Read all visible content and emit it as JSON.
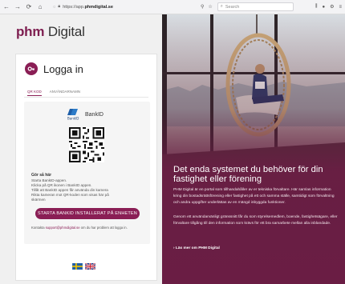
{
  "browser": {
    "url_prefix": "https://app.",
    "url_domain": "phmdigital.se",
    "search_placeholder": "Search"
  },
  "brand": {
    "phm": "phm",
    "digital": "Digital"
  },
  "login": {
    "title": "Logga in",
    "tabs": [
      "QR KOD",
      "ANVÄNDARNAMN"
    ],
    "bankid_label": "BankID",
    "how_title": "Gör så här",
    "steps": [
      "Starta BankID-appen.",
      "Klicka på QR ikonen i BankID appen.",
      "Tillåt att BankID appen får använda din kamera",
      "Rikta kameran mot QR-koden som visas här på",
      "skärmen"
    ],
    "start_button": "STARTA BANKID INSTALLERAT PÅ ENHETEN",
    "support_prefix": "Kontakta ",
    "support_link": "support@phmdigital.se",
    "support_suffix": " om du har problem att logga in."
  },
  "hero": {
    "title": "Det enda systemet du behöver för din fastighet eller förening",
    "p1": "PHM Digital är en portal som tillhandahåller av er tekniska förvaltare. Här samlas information kring din bostadsrättsförening eller fastighet på ett och samma ställe, samtidigt som förvaltning och andra uppgifter underlättas av en mängd inbyggda funktioner.",
    "p2": "Genom ett användarvänligt gränssnitt får du som styrelsemedlem, boende, fastighetsägare, eller förvaltare tillgång till den information som krävs för ett bra samarbete mellan alla inblandade.",
    "link": "› Läs mer om PHM Digital"
  },
  "colors": {
    "brand": "#8a1e55",
    "hero_bg": "#5a2a3c"
  }
}
